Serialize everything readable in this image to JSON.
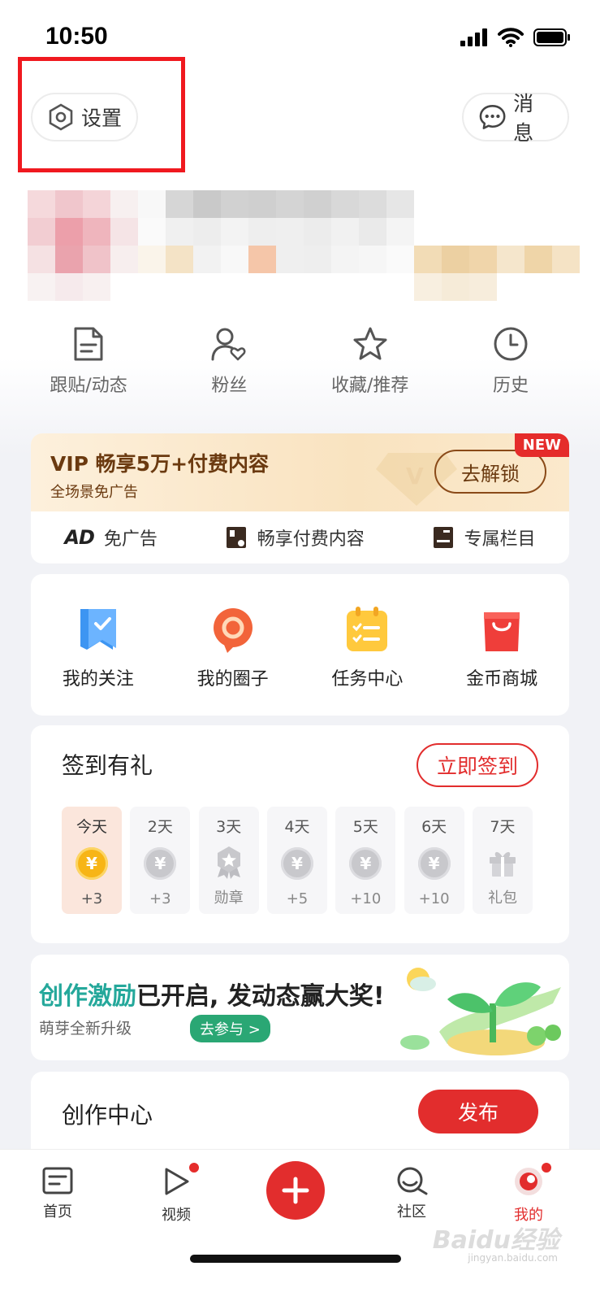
{
  "status_bar": {
    "time": "10:50"
  },
  "top": {
    "settings_label": "设置",
    "messages_label": "消息"
  },
  "quick_row": [
    {
      "label": "跟贴/动态",
      "icon": "document-icon"
    },
    {
      "label": "粉丝",
      "icon": "user-heart-icon"
    },
    {
      "label": "收藏/推荐",
      "icon": "star-icon"
    },
    {
      "label": "历史",
      "icon": "clock-icon"
    }
  ],
  "vip": {
    "title": "VIP 畅享5万+付费内容",
    "subtitle": "全场景免广告",
    "unlock_label": "去解锁",
    "new_badge": "NEW",
    "features": [
      {
        "badge": "AD",
        "label": "免广告"
      },
      {
        "label": "畅享付费内容"
      },
      {
        "label": "专属栏目"
      }
    ]
  },
  "services": [
    {
      "label": "我的关注"
    },
    {
      "label": "我的圈子"
    },
    {
      "label": "任务中心"
    },
    {
      "label": "金币商城"
    }
  ],
  "checkin": {
    "title": "签到有礼",
    "button_label": "立即签到",
    "days": [
      {
        "day": "今天",
        "reward": "+3",
        "type": "coin-today"
      },
      {
        "day": "2天",
        "reward": "+3",
        "type": "coin"
      },
      {
        "day": "3天",
        "reward": "勋章",
        "type": "medal"
      },
      {
        "day": "4天",
        "reward": "+5",
        "type": "coin"
      },
      {
        "day": "5天",
        "reward": "+10",
        "type": "coin"
      },
      {
        "day": "6天",
        "reward": "+10",
        "type": "coin"
      },
      {
        "day": "7天",
        "reward": "礼包",
        "type": "gift"
      }
    ]
  },
  "banner": {
    "title_accent": "创作激励",
    "title_rest": "已开启, 发动态赢大奖!",
    "subtitle": "萌芽全新升级",
    "go_label": "去参与 >"
  },
  "creator": {
    "title": "创作中心",
    "publish_label": "发布"
  },
  "bottom_nav": [
    {
      "label": "首页",
      "active": false
    },
    {
      "label": "视频",
      "active": false,
      "dot": true
    },
    {
      "label": "社区",
      "active": false
    },
    {
      "label": "我的",
      "active": true,
      "dot": true
    }
  ],
  "watermark": {
    "main": "Baidu经验",
    "sub": "jingyan.baidu.com"
  },
  "colors": {
    "accent": "#e22d2d",
    "vip_text": "#6b3a10",
    "teal": "#25a89b",
    "highlight": "#f0191f"
  }
}
